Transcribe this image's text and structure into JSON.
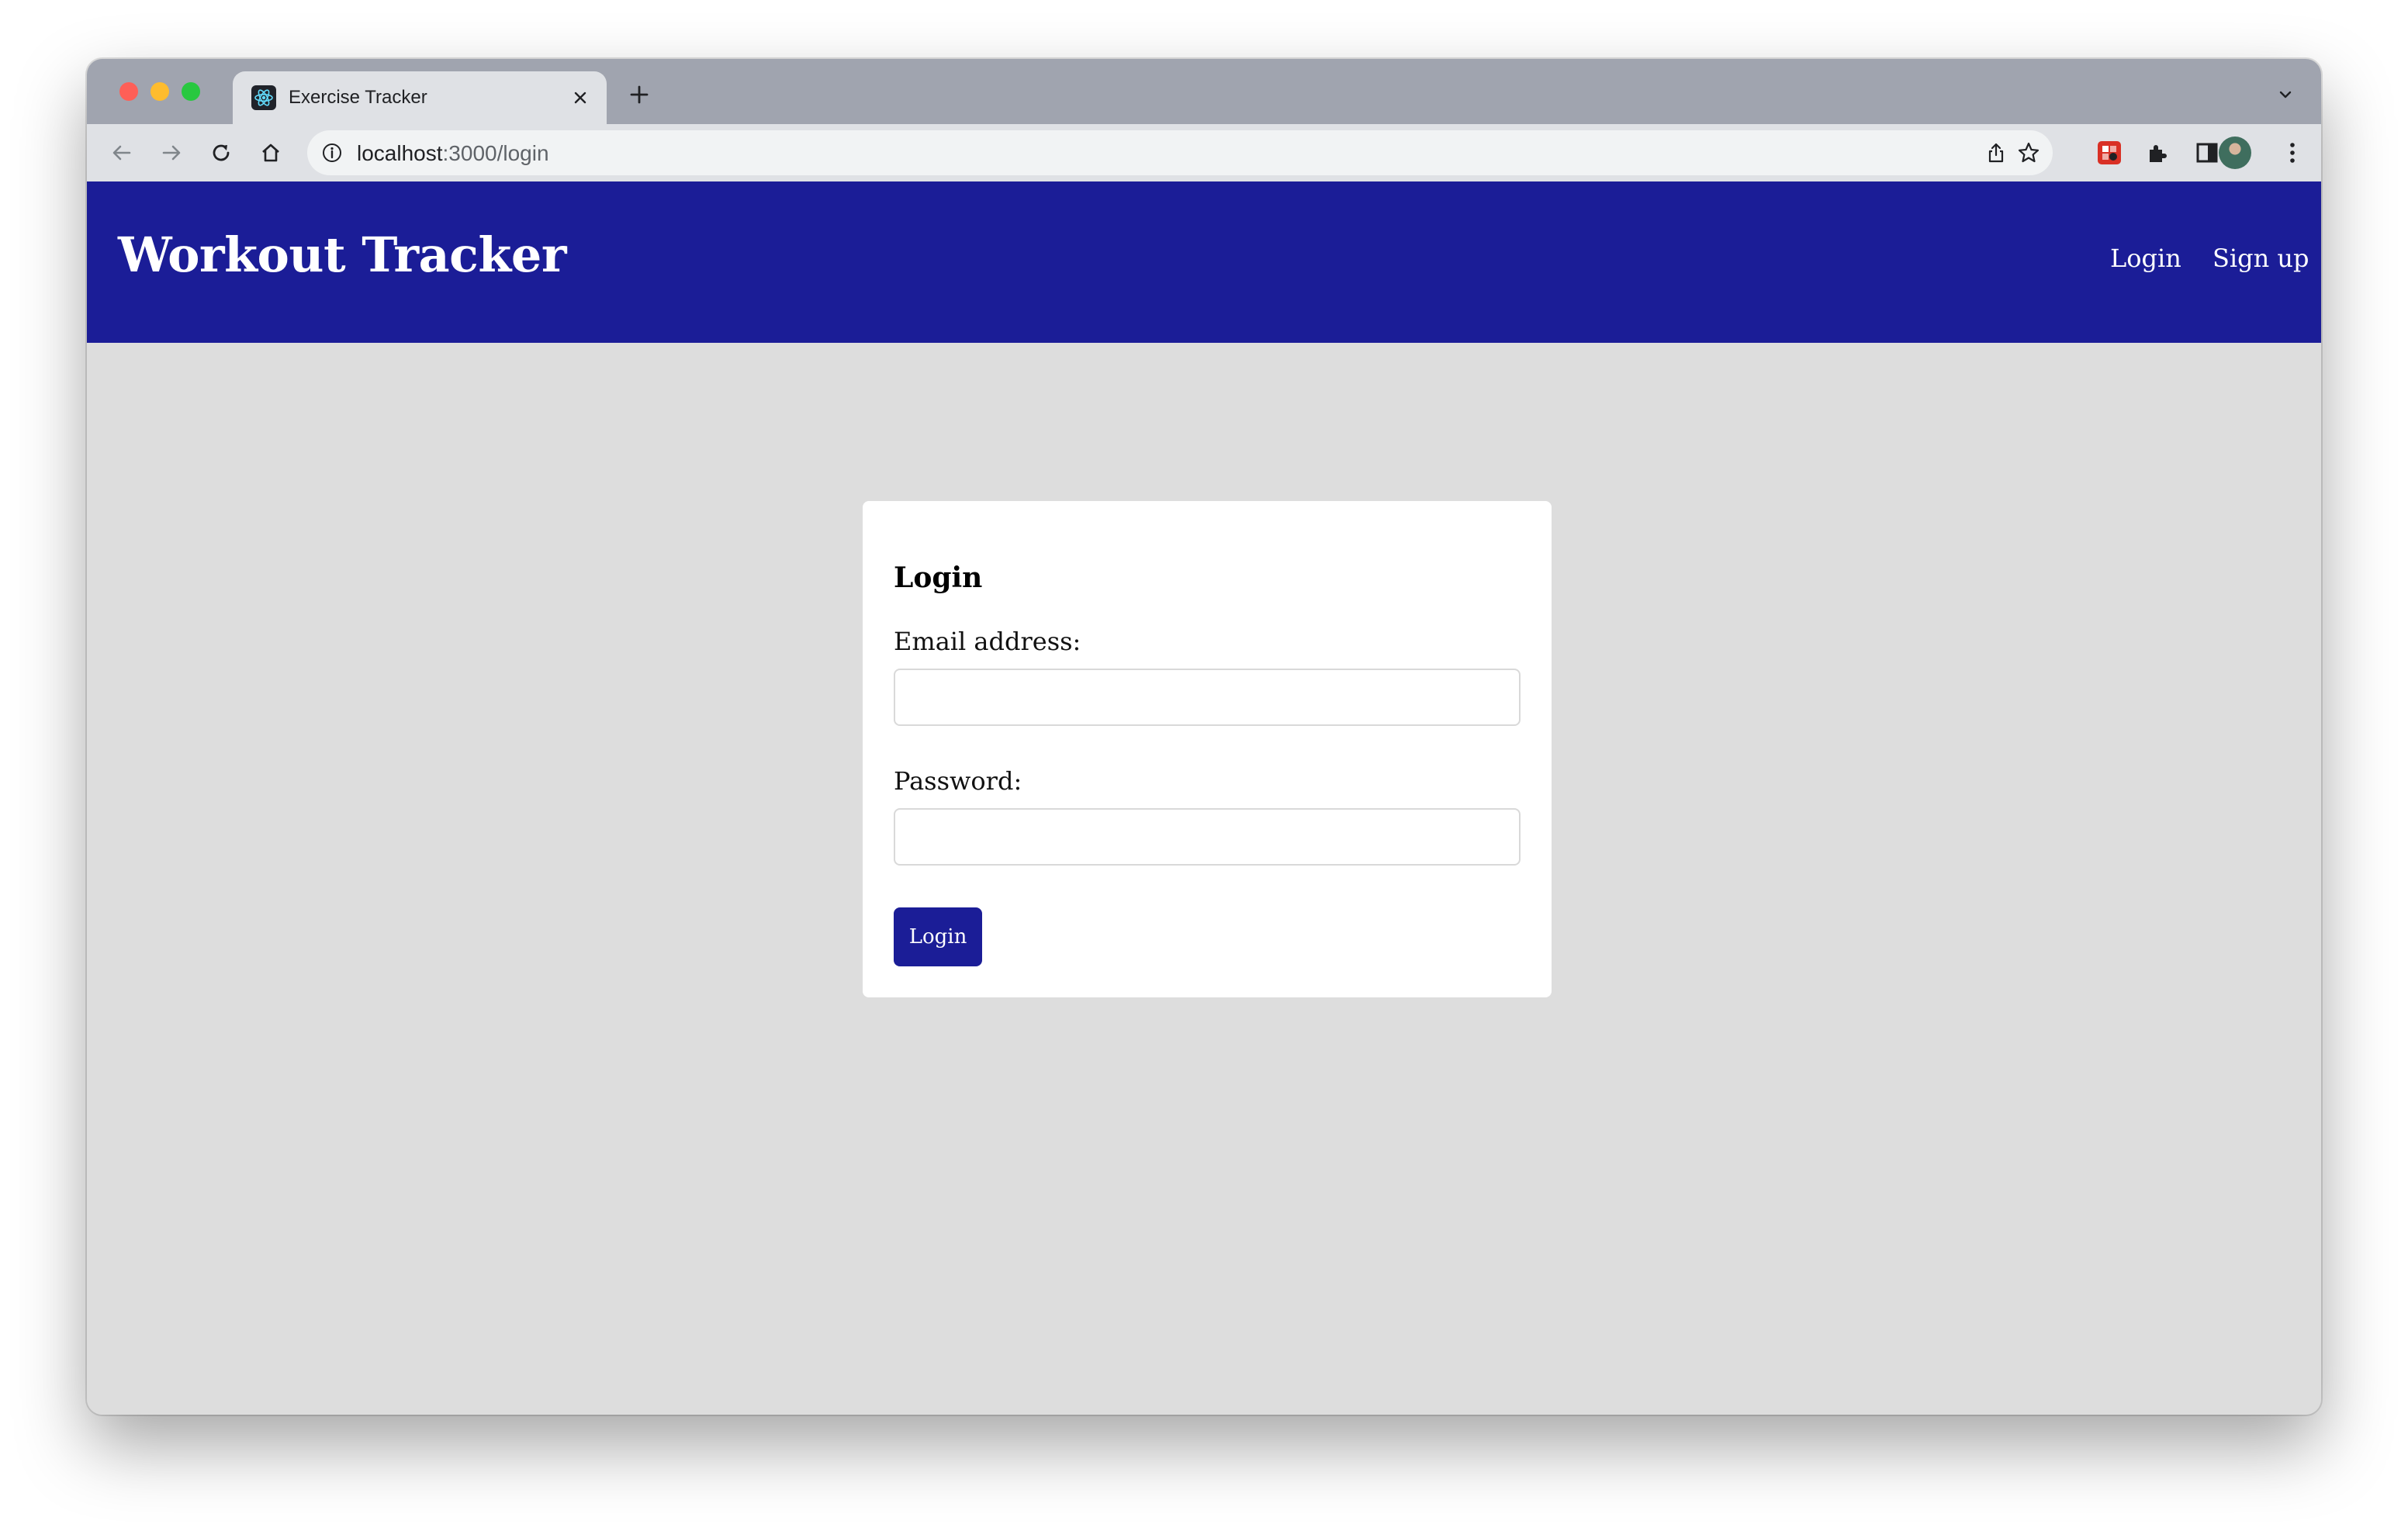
{
  "browser": {
    "tab": {
      "title": "Exercise Tracker",
      "favicon": "react-logo-icon"
    },
    "address_bar": {
      "host": "localhost",
      "path": ":3000/login"
    }
  },
  "app": {
    "brand": "Workout Tracker",
    "nav": {
      "login": "Login",
      "signup": "Sign up"
    },
    "colors": {
      "primary": "#1b1d97",
      "page_background": "#dddddd"
    }
  },
  "login_form": {
    "title": "Login",
    "email_label": "Email address:",
    "email_value": "",
    "password_label": "Password:",
    "password_value": "",
    "submit_label": "Login"
  }
}
